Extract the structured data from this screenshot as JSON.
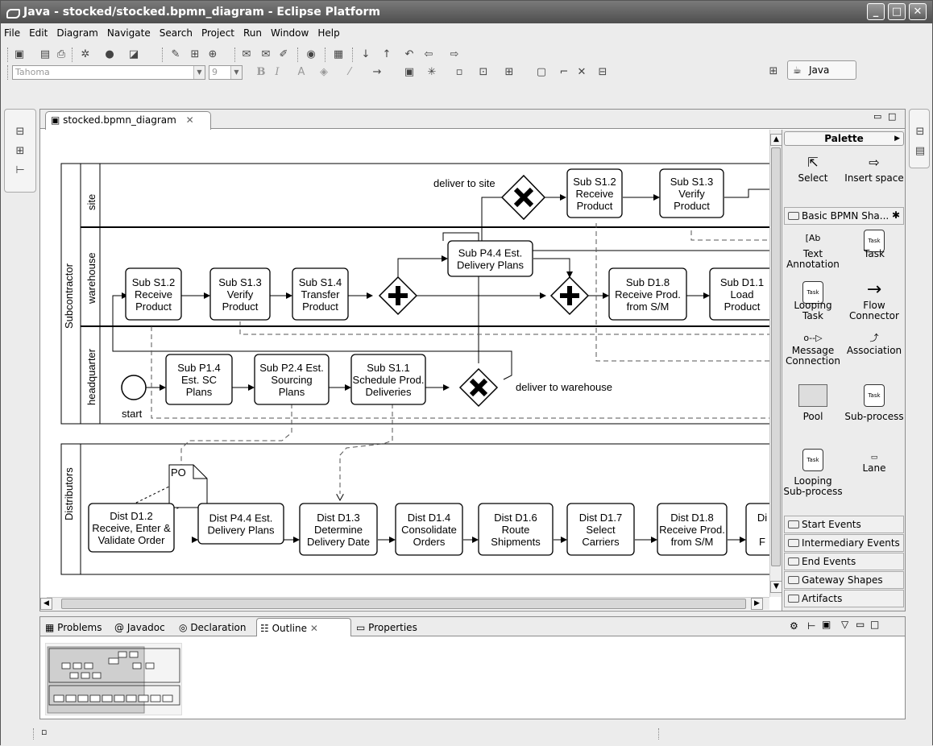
{
  "window": {
    "title": "Java - stocked/stocked.bpmn_diagram - Eclipse Platform"
  },
  "menu": [
    "File",
    "Edit",
    "Diagram",
    "Navigate",
    "Search",
    "Project",
    "Run",
    "Window",
    "Help"
  ],
  "toolbar": {
    "font_name": "Tahoma",
    "font_size": "9",
    "bold": "B",
    "italic": "I",
    "perspective": "Java"
  },
  "editor": {
    "tab": "stocked.bpmn_diagram"
  },
  "diagram": {
    "pools": [
      {
        "name": "Subcontractor",
        "lanes": [
          "site",
          "warehouse",
          "headquarter"
        ]
      },
      {
        "name": "Distributors"
      }
    ],
    "tasks": [
      {
        "id": "s-s12",
        "lines": [
          "Sub S1.2",
          "Receive",
          "Product"
        ]
      },
      {
        "id": "s-s13",
        "lines": [
          "Sub S1.3",
          "Verify",
          "Product"
        ]
      },
      {
        "id": "w-s12",
        "lines": [
          "Sub S1.2",
          "Receive",
          "Product"
        ]
      },
      {
        "id": "w-s13",
        "lines": [
          "Sub S1.3",
          "Verify",
          "Product"
        ]
      },
      {
        "id": "w-s14",
        "lines": [
          "Sub S1.4",
          "Transfer",
          "Product"
        ]
      },
      {
        "id": "w-p44",
        "lines": [
          "Sub P4.4 Est.",
          "Delivery Plans"
        ]
      },
      {
        "id": "w-d18",
        "lines": [
          "Sub D1.8",
          "Receive Prod.",
          "from S/M"
        ]
      },
      {
        "id": "w-d11",
        "lines": [
          "Sub D1.1",
          "Load",
          "Product"
        ]
      },
      {
        "id": "h-p14",
        "lines": [
          "Sub P1.4",
          "Est. SC",
          "Plans"
        ]
      },
      {
        "id": "h-p24",
        "lines": [
          "Sub P2.4 Est.",
          "Sourcing",
          "Plans"
        ]
      },
      {
        "id": "h-s11",
        "lines": [
          "Sub S1.1",
          "Schedule Prod.",
          "Deliveries"
        ]
      },
      {
        "id": "d-d12",
        "lines": [
          "Dist D1.2",
          "Receive, Enter &",
          "Validate Order"
        ]
      },
      {
        "id": "d-p44",
        "lines": [
          "Dist P4.4 Est.",
          "Delivery Plans"
        ]
      },
      {
        "id": "d-d13",
        "lines": [
          "Dist D1.3",
          "Determine",
          "Delivery Date"
        ]
      },
      {
        "id": "d-d14",
        "lines": [
          "Dist D1.4",
          "Consolidate",
          "Orders"
        ]
      },
      {
        "id": "d-d16",
        "lines": [
          "Dist D1.6",
          "Route",
          "Shipments"
        ]
      },
      {
        "id": "d-d17",
        "lines": [
          "Dist D1.7",
          "Select",
          "Carriers"
        ]
      },
      {
        "id": "d-d18",
        "lines": [
          "Dist D1.8",
          "Receive Prod.",
          "from S/M"
        ]
      },
      {
        "id": "d-d19",
        "lines": [
          "Di",
          "",
          "F"
        ]
      }
    ],
    "labels": {
      "deliver_site": "deliver to site",
      "deliver_warehouse": "deliver to warehouse",
      "start": "start",
      "po": "PO"
    }
  },
  "palette": {
    "title": "Palette",
    "tools": [
      {
        "label": "Select",
        "icon": "arrow-pointer"
      },
      {
        "label": "Insert space",
        "icon": "insert-space"
      }
    ],
    "section": "Basic BPMN Sha...",
    "items": [
      {
        "label": "Text Annotation",
        "icon": "text-annotation"
      },
      {
        "label": "Task",
        "icon": "task"
      },
      {
        "label": "Looping Task",
        "icon": "looping-task"
      },
      {
        "label": "Flow Connector",
        "icon": "flow-arrow"
      },
      {
        "label": "Message Connection",
        "icon": "message-connection"
      },
      {
        "label": "Association",
        "icon": "association"
      },
      {
        "label": "Pool",
        "icon": "pool"
      },
      {
        "label": "Sub-process",
        "icon": "subprocess"
      },
      {
        "label": "Looping Sub-process",
        "icon": "looping-subprocess"
      },
      {
        "label": "Lane",
        "icon": "lane"
      }
    ],
    "drawers": [
      "Start Events",
      "Intermediary Events",
      "End Events",
      "Gateway Shapes",
      "Artifacts"
    ],
    "mini_task": "Task"
  },
  "bottom": {
    "tabs": [
      "Problems",
      "Javadoc",
      "Declaration",
      "Outline",
      "Properties"
    ]
  }
}
